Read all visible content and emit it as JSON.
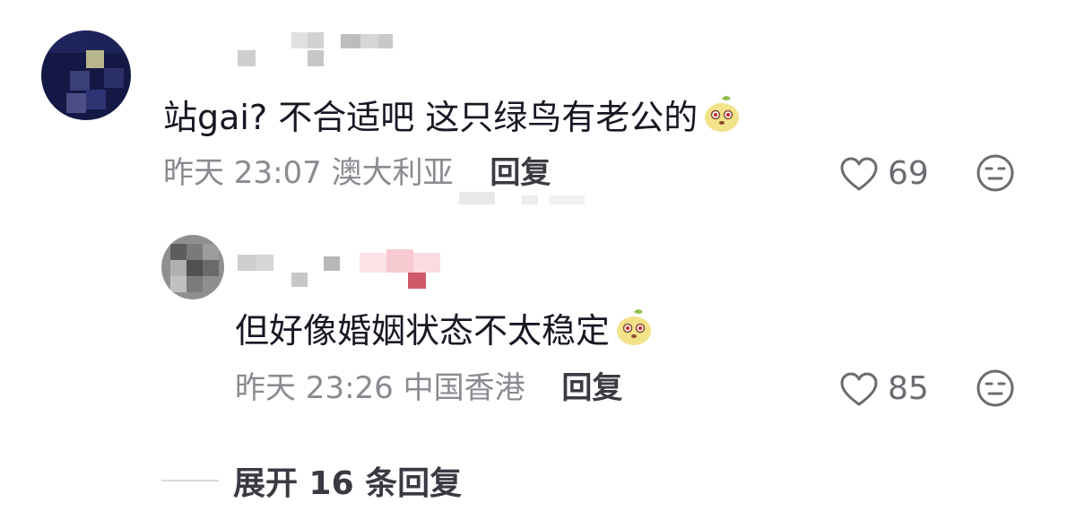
{
  "comments": [
    {
      "text": "站gai? 不合适吧 这只绿鸟有老公的",
      "emoji_icon": "mango-face-emoji",
      "time": "昨天 23:07",
      "location": "澳大利亚",
      "reply_label": "回复",
      "likes": "69",
      "dislike_icon": "meh-face-icon"
    }
  ],
  "replies": [
    {
      "text": "但好像婚姻状态不太稳定",
      "emoji_icon": "mango-face-emoji",
      "time": "昨天 23:26",
      "location": "中国香港",
      "reply_label": "回复",
      "likes": "85",
      "dislike_icon": "meh-face-icon"
    }
  ],
  "expand_label": "展开 16 条回复",
  "colors": {
    "primary_text": "#161823",
    "meta_text": "#8a8b91",
    "action_text": "#3a3b42"
  }
}
